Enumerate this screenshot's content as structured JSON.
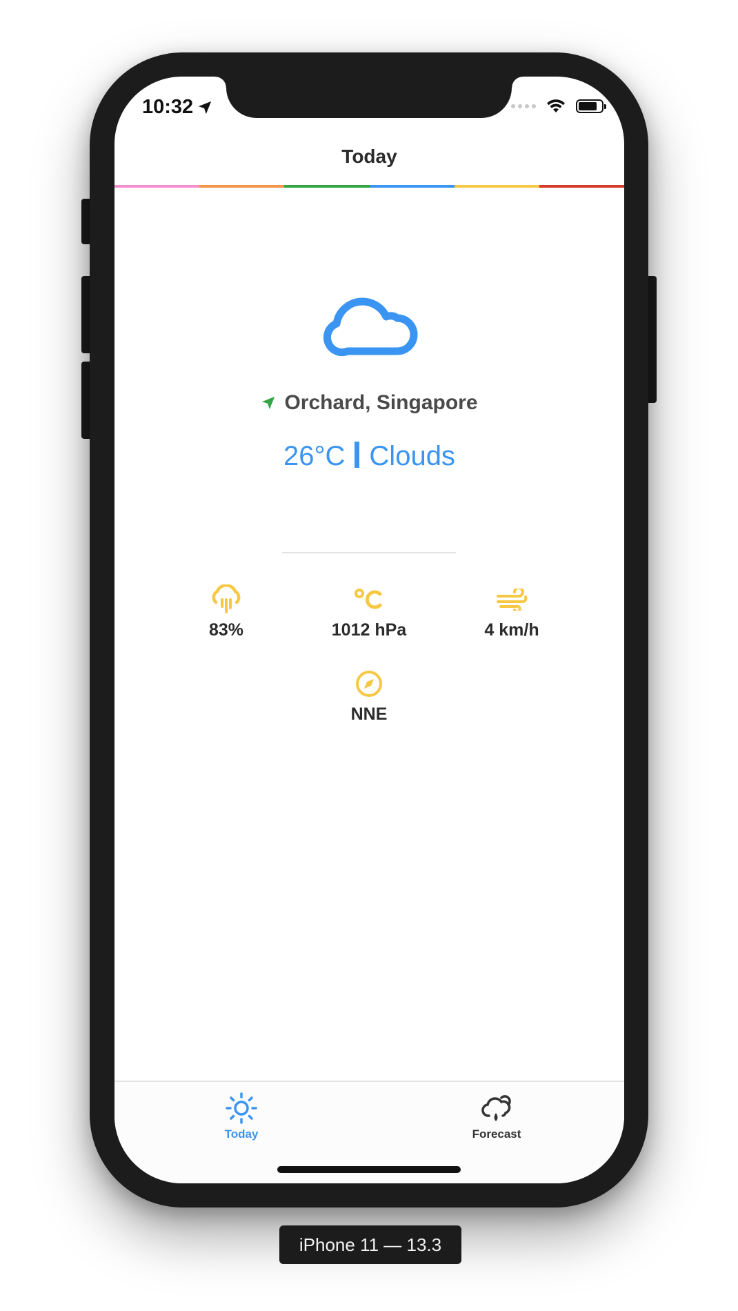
{
  "status_bar": {
    "time": "10:32",
    "icons": [
      "location-arrow-icon",
      "signal-dots-icon",
      "wifi-icon",
      "battery-icon"
    ]
  },
  "nav": {
    "title": "Today",
    "stripe_colors": [
      "#f58fd0",
      "#f3954a",
      "#33a543",
      "#3a94f2",
      "#f7c844",
      "#d63a2c"
    ]
  },
  "current": {
    "icon": "cloud-icon",
    "location_icon": "location-arrow-icon",
    "location": "Orchard, Singapore",
    "temperature": "26°C",
    "condition": "Clouds"
  },
  "stats": {
    "humidity": {
      "icon": "rain-cloud-icon",
      "value": "83%"
    },
    "pressure": {
      "icon": "celsius-icon",
      "value": "1012 hPa"
    },
    "wind": {
      "icon": "wind-icon",
      "value": "4  km/h"
    },
    "direction": {
      "icon": "compass-icon",
      "value": "NNE"
    }
  },
  "tabs": [
    {
      "label": "Today",
      "icon": "sun-icon",
      "active": true
    },
    {
      "label": "Forecast",
      "icon": "cloud-sun-rain-icon",
      "active": false
    }
  ],
  "device_label": "iPhone 11 — 13.3",
  "colors": {
    "accent_blue": "#3a94f2",
    "stat_yellow": "#f7c844",
    "location_green": "#33a543",
    "device_frame": "#1c1c1c"
  }
}
